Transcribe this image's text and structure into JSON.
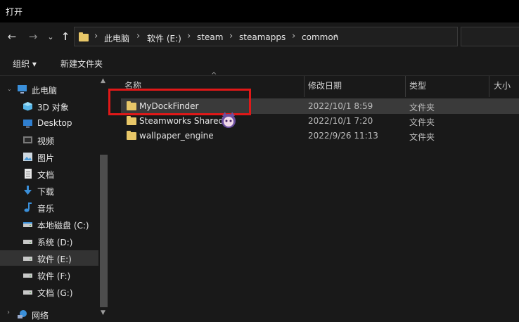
{
  "window": {
    "title": "打开"
  },
  "nav": {
    "back": "←",
    "forward": "→",
    "recent": "⌄",
    "up": "↑",
    "breadcrumbs": [
      "此电脑",
      "软件 (E:)",
      "steam",
      "steamapps",
      "common"
    ],
    "dropdown_glyph": "⌄",
    "refresh_glyph": "↻"
  },
  "toolbar": {
    "organize": "组织 ▾",
    "new_folder": "新建文件夹"
  },
  "sidebar": {
    "items": [
      {
        "label": "此电脑",
        "icon": "pc-icon"
      },
      {
        "label": "3D 对象",
        "icon": "cube-icon"
      },
      {
        "label": "Desktop",
        "icon": "desktop-icon"
      },
      {
        "label": "视频",
        "icon": "video-icon"
      },
      {
        "label": "图片",
        "icon": "picture-icon"
      },
      {
        "label": "文档",
        "icon": "document-icon"
      },
      {
        "label": "下载",
        "icon": "download-icon"
      },
      {
        "label": "音乐",
        "icon": "music-icon"
      },
      {
        "label": "本地磁盘 (C:)",
        "icon": "drive-icon"
      },
      {
        "label": "系统 (D:)",
        "icon": "drive-icon"
      },
      {
        "label": "软件 (E:)",
        "icon": "drive-icon"
      },
      {
        "label": "软件 (F:)",
        "icon": "drive-icon"
      },
      {
        "label": "文档 (G:)",
        "icon": "drive-icon"
      },
      {
        "label": "网络",
        "icon": "network-icon"
      }
    ]
  },
  "columns": {
    "name": "名称",
    "date": "修改日期",
    "type": "类型",
    "size": "大小",
    "sort_glyph": "^"
  },
  "files": [
    {
      "name": "MyDockFinder",
      "date": "2022/10/1 8:59",
      "type": "文件夹"
    },
    {
      "name": "Steamworks Shared",
      "date": "2022/10/1 7:20",
      "type": "文件夹"
    },
    {
      "name": "wallpaper_engine",
      "date": "2022/9/26 11:13",
      "type": "文件夹"
    }
  ],
  "colors": {
    "highlight": "#e01818",
    "folder": "#e8c768",
    "selected_row": "#3a3a3a"
  }
}
